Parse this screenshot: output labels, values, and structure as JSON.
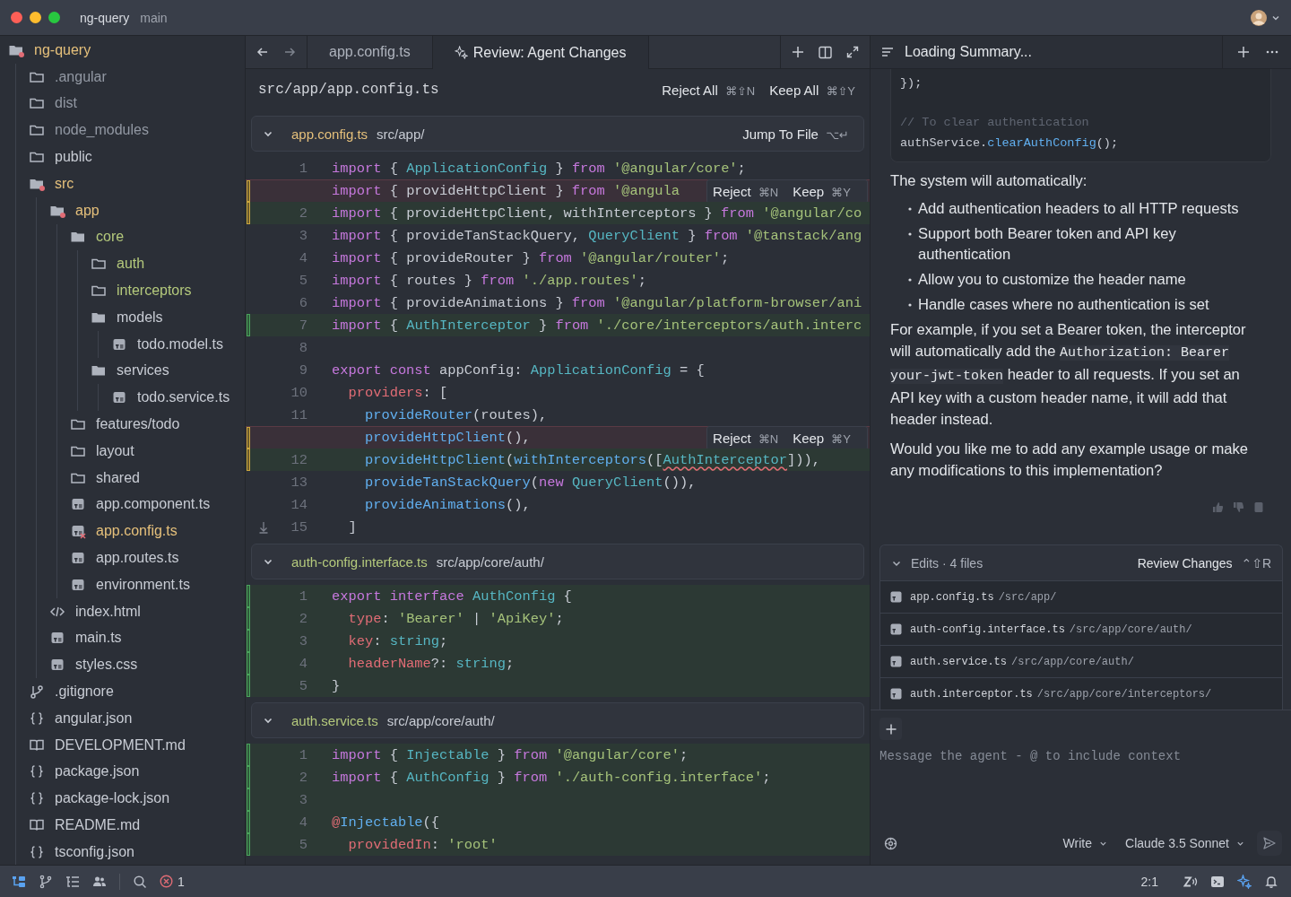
{
  "title_bar": {
    "project": "ng-query",
    "branch": "main"
  },
  "sidebar": {
    "items": [
      {
        "name": "ng-query",
        "kind": "folder-open",
        "color": "#e5c07b",
        "modified": true,
        "children": [
          {
            "name": ".angular",
            "kind": "folder",
            "color": "#9298a3",
            "modified": false
          },
          {
            "name": "dist",
            "kind": "folder",
            "color": "#9298a3",
            "modified": false
          },
          {
            "name": "node_modules",
            "kind": "folder",
            "color": "#9298a3",
            "modified": false
          },
          {
            "name": "public",
            "kind": "folder",
            "color": "#c8ccd4",
            "modified": false
          },
          {
            "name": "src",
            "kind": "folder-open",
            "color": "#e5c07b",
            "modified": true,
            "children": [
              {
                "name": "app",
                "kind": "folder-open",
                "color": "#e5c07b",
                "modified": true,
                "children": [
                  {
                    "name": "core",
                    "kind": "folder-open",
                    "color": "#b4c97c",
                    "modified": false,
                    "children": [
                      {
                        "name": "auth",
                        "kind": "folder",
                        "color": "#b4c97c",
                        "modified": false
                      },
                      {
                        "name": "interceptors",
                        "kind": "folder",
                        "color": "#b4c97c",
                        "modified": false
                      },
                      {
                        "name": "models",
                        "kind": "folder-open",
                        "color": "#c8ccd4",
                        "modified": false,
                        "children": [
                          {
                            "name": "todo.model.ts",
                            "kind": "ts",
                            "color": "#c8ccd4",
                            "modified": false
                          }
                        ]
                      },
                      {
                        "name": "services",
                        "kind": "folder-open",
                        "color": "#c8ccd4",
                        "modified": false,
                        "children": [
                          {
                            "name": "todo.service.ts",
                            "kind": "ts",
                            "color": "#c8ccd4",
                            "modified": false
                          }
                        ]
                      }
                    ]
                  },
                  {
                    "name": "features/todo",
                    "kind": "folder",
                    "color": "#c8ccd4",
                    "modified": false
                  },
                  {
                    "name": "layout",
                    "kind": "folder",
                    "color": "#c8ccd4",
                    "modified": false
                  },
                  {
                    "name": "shared",
                    "kind": "folder",
                    "color": "#c8ccd4",
                    "modified": false
                  },
                  {
                    "name": "app.component.ts",
                    "kind": "ts",
                    "color": "#c8ccd4",
                    "modified": false
                  },
                  {
                    "name": "app.config.ts",
                    "kind": "ts",
                    "color": "#e5c07b",
                    "modified": true
                  },
                  {
                    "name": "app.routes.ts",
                    "kind": "ts",
                    "color": "#c8ccd4",
                    "modified": false
                  },
                  {
                    "name": "environment.ts",
                    "kind": "ts",
                    "color": "#c8ccd4",
                    "modified": false
                  }
                ]
              },
              {
                "name": "index.html",
                "kind": "html",
                "color": "#c8ccd4",
                "modified": false
              },
              {
                "name": "main.ts",
                "kind": "ts",
                "color": "#c8ccd4",
                "modified": false
              },
              {
                "name": "styles.css",
                "kind": "css",
                "color": "#c8ccd4",
                "modified": false
              }
            ]
          },
          {
            "name": ".gitignore",
            "kind": "git",
            "color": "#c8ccd4",
            "modified": false
          },
          {
            "name": "angular.json",
            "kind": "json",
            "color": "#c8ccd4",
            "modified": false
          },
          {
            "name": "DEVELOPMENT.md",
            "kind": "md",
            "color": "#c8ccd4",
            "modified": false
          },
          {
            "name": "package.json",
            "kind": "json",
            "color": "#c8ccd4",
            "modified": false
          },
          {
            "name": "package-lock.json",
            "kind": "json",
            "color": "#c8ccd4",
            "modified": false
          },
          {
            "name": "README.md",
            "kind": "md",
            "color": "#c8ccd4",
            "modified": false
          },
          {
            "name": "tsconfig.json",
            "kind": "json",
            "color": "#c8ccd4",
            "modified": false
          }
        ]
      }
    ]
  },
  "editor": {
    "tabs": [
      {
        "label": "app.config.ts",
        "kind": "file",
        "selected": false
      },
      {
        "label": "Review: Agent Changes",
        "kind": "review",
        "selected": true
      }
    ],
    "review_header": {
      "path": "src/app/app.config.ts",
      "actions": [
        {
          "label": "Reject All",
          "keys": "⌘⇧N"
        },
        {
          "label": "Keep All",
          "keys": "⌘⇧Y"
        }
      ]
    },
    "sections": [
      {
        "name": "app.config.ts",
        "path": "src/app/",
        "color": "#e5c07b",
        "expanded": true,
        "jump": {
          "label": "Jump To File",
          "keys": "⌥↵"
        },
        "lines": [
          {
            "num": "1",
            "kind": "plain",
            "tokens": [
              {
                "kind": "keyword",
                "text": "import"
              },
              {
                "kind": "plain",
                "text": " { "
              },
              {
                "kind": "type",
                "text": "ApplicationConfig"
              },
              {
                "kind": "plain",
                "text": " } "
              },
              {
                "kind": "keyword",
                "text": "from "
              },
              {
                "kind": "string",
                "text": "'@angular/core'"
              },
              {
                "kind": "plain",
                "text": ";"
              }
            ]
          },
          {
            "kind": "removed",
            "tokens": [
              {
                "kind": "keyword",
                "text": "import"
              },
              {
                "kind": "plain",
                "text": " { provideHttpClient } "
              },
              {
                "kind": "keyword",
                "text": "from "
              },
              {
                "kind": "string",
                "text": "'@angula"
              }
            ],
            "actions": [
              {
                "label": "Reject",
                "keys": "⌘N"
              },
              {
                "label": "Keep",
                "keys": "⌘Y"
              }
            ]
          },
          {
            "num": "2",
            "kind": "changed",
            "tokens": [
              {
                "kind": "keyword",
                "text": "import"
              },
              {
                "kind": "plain",
                "text": " { provideHttpClient, withInterceptors } "
              },
              {
                "kind": "keyword",
                "text": "from "
              },
              {
                "kind": "string",
                "text": "'@angular/co"
              }
            ]
          },
          {
            "num": "3",
            "kind": "plain",
            "tokens": [
              {
                "kind": "keyword",
                "text": "import"
              },
              {
                "kind": "plain",
                "text": " { provideTanStackQuery, "
              },
              {
                "kind": "type",
                "text": "QueryClient"
              },
              {
                "kind": "plain",
                "text": " } "
              },
              {
                "kind": "keyword",
                "text": "from "
              },
              {
                "kind": "string",
                "text": "'@tanstack/ang"
              }
            ]
          },
          {
            "num": "4",
            "kind": "plain",
            "tokens": [
              {
                "kind": "keyword",
                "text": "import"
              },
              {
                "kind": "plain",
                "text": " { provideRouter } "
              },
              {
                "kind": "keyword",
                "text": "from "
              },
              {
                "kind": "string",
                "text": "'@angular/router'"
              },
              {
                "kind": "plain",
                "text": ";"
              }
            ]
          },
          {
            "num": "5",
            "kind": "plain",
            "tokens": [
              {
                "kind": "keyword",
                "text": "import"
              },
              {
                "kind": "plain",
                "text": " { routes } "
              },
              {
                "kind": "keyword",
                "text": "from "
              },
              {
                "kind": "string",
                "text": "'./app.routes'"
              },
              {
                "kind": "plain",
                "text": ";"
              }
            ]
          },
          {
            "num": "6",
            "kind": "plain",
            "tokens": [
              {
                "kind": "keyword",
                "text": "import"
              },
              {
                "kind": "plain",
                "text": " { provideAnimations } "
              },
              {
                "kind": "keyword",
                "text": "from "
              },
              {
                "kind": "string",
                "text": "'@angular/platform-browser/ani"
              }
            ]
          },
          {
            "num": "7",
            "kind": "added",
            "tokens": [
              {
                "kind": "keyword",
                "text": "import"
              },
              {
                "kind": "plain",
                "text": " { "
              },
              {
                "kind": "type",
                "text": "AuthInterceptor"
              },
              {
                "kind": "plain",
                "text": " } "
              },
              {
                "kind": "keyword",
                "text": "from "
              },
              {
                "kind": "string",
                "text": "'./core/interceptors/auth.interc"
              }
            ]
          },
          {
            "num": "8",
            "kind": "plain"
          },
          {
            "num": "9",
            "kind": "plain",
            "tokens": [
              {
                "kind": "keyword",
                "text": "export const"
              },
              {
                "kind": "plain",
                "text": " appConfig: "
              },
              {
                "kind": "type",
                "text": "ApplicationConfig"
              },
              {
                "kind": "plain",
                "text": " = {"
              }
            ]
          },
          {
            "num": "10",
            "kind": "plain",
            "tokens": [
              {
                "kind": "property",
                "text": "  providers"
              },
              {
                "kind": "plain",
                "text": ": ["
              }
            ]
          },
          {
            "num": "11",
            "kind": "plain",
            "tokens": [
              {
                "kind": "function",
                "text": "    provideRouter"
              },
              {
                "kind": "plain",
                "text": "(routes),"
              }
            ]
          },
          {
            "kind": "removed",
            "tokens": [
              {
                "kind": "function",
                "text": "    provideHttpClient"
              },
              {
                "kind": "plain",
                "text": "(),"
              }
            ],
            "actions": [
              {
                "label": "Reject",
                "keys": "⌘N"
              },
              {
                "label": "Keep",
                "keys": "⌘Y"
              }
            ]
          },
          {
            "num": "12",
            "kind": "changed",
            "tokens": [
              {
                "kind": "function",
                "text": "    provideHttpClient"
              },
              {
                "kind": "plain",
                "text": "("
              },
              {
                "kind": "function",
                "text": "withInterceptors"
              },
              {
                "kind": "plain",
                "text": "(["
              },
              {
                "kind": "error",
                "text": "AuthInterceptor"
              },
              {
                "kind": "plain",
                "text": "])),"
              }
            ]
          },
          {
            "num": "13",
            "kind": "plain",
            "tokens": [
              {
                "kind": "function",
                "text": "    provideTanStackQuery"
              },
              {
                "kind": "plain",
                "text": "("
              },
              {
                "kind": "keyword",
                "text": "new "
              },
              {
                "kind": "type",
                "text": "QueryClient"
              },
              {
                "kind": "plain",
                "text": "()),"
              }
            ]
          },
          {
            "num": "14",
            "kind": "plain",
            "tokens": [
              {
                "kind": "function",
                "text": "    provideAnimations"
              },
              {
                "kind": "plain",
                "text": "(),"
              }
            ]
          },
          {
            "num": "15",
            "kind": "plain",
            "fold": true,
            "tokens": [
              {
                "kind": "plain",
                "text": "  ]"
              }
            ]
          }
        ]
      },
      {
        "name": "auth-config.interface.ts",
        "path": "src/app/core/auth/",
        "color": "#b4c97c",
        "expanded": true,
        "lines": [
          {
            "num": "1",
            "kind": "added",
            "tokens": [
              {
                "kind": "keyword",
                "text": "export interface "
              },
              {
                "kind": "type",
                "text": "AuthConfig"
              },
              {
                "kind": "plain",
                "text": " {"
              }
            ]
          },
          {
            "num": "2",
            "kind": "added",
            "tokens": [
              {
                "kind": "property",
                "text": "  type"
              },
              {
                "kind": "plain",
                "text": ": "
              },
              {
                "kind": "string",
                "text": "'Bearer'"
              },
              {
                "kind": "plain",
                "text": " | "
              },
              {
                "kind": "string",
                "text": "'ApiKey'"
              },
              {
                "kind": "plain",
                "text": ";"
              }
            ]
          },
          {
            "num": "3",
            "kind": "added",
            "tokens": [
              {
                "kind": "property",
                "text": "  key"
              },
              {
                "kind": "plain",
                "text": ": "
              },
              {
                "kind": "type",
                "text": "string"
              },
              {
                "kind": "plain",
                "text": ";"
              }
            ]
          },
          {
            "num": "4",
            "kind": "added",
            "tokens": [
              {
                "kind": "property",
                "text": "  headerName"
              },
              {
                "kind": "plain",
                "text": "?: "
              },
              {
                "kind": "type",
                "text": "string"
              },
              {
                "kind": "plain",
                "text": ";"
              }
            ]
          },
          {
            "num": "5",
            "kind": "added",
            "tokens": [
              {
                "kind": "plain",
                "text": "}"
              }
            ]
          }
        ]
      },
      {
        "name": "auth.service.ts",
        "path": "src/app/core/auth/",
        "color": "#b4c97c",
        "expanded": true,
        "lines": [
          {
            "num": "1",
            "kind": "added",
            "tokens": [
              {
                "kind": "keyword",
                "text": "import"
              },
              {
                "kind": "plain",
                "text": " { "
              },
              {
                "kind": "type",
                "text": "Injectable"
              },
              {
                "kind": "plain",
                "text": " } "
              },
              {
                "kind": "keyword",
                "text": "from "
              },
              {
                "kind": "string",
                "text": "'@angular/core'"
              },
              {
                "kind": "plain",
                "text": ";"
              }
            ]
          },
          {
            "num": "2",
            "kind": "added",
            "tokens": [
              {
                "kind": "keyword",
                "text": "import"
              },
              {
                "kind": "plain",
                "text": " { "
              },
              {
                "kind": "type",
                "text": "AuthConfig"
              },
              {
                "kind": "plain",
                "text": " } "
              },
              {
                "kind": "keyword",
                "text": "from "
              },
              {
                "kind": "string",
                "text": "'./auth-config.interface'"
              },
              {
                "kind": "plain",
                "text": ";"
              }
            ]
          },
          {
            "num": "3",
            "kind": "added"
          },
          {
            "num": "4",
            "kind": "added",
            "tokens": [
              {
                "kind": "property",
                "text": "@"
              },
              {
                "kind": "function",
                "text": "Injectable"
              },
              {
                "kind": "plain",
                "text": "({"
              }
            ]
          },
          {
            "num": "5",
            "kind": "added",
            "tokens": [
              {
                "kind": "property",
                "text": "  providedIn"
              },
              {
                "kind": "plain",
                "text": ": "
              },
              {
                "kind": "string",
                "text": "'root'"
              }
            ]
          }
        ]
      }
    ]
  },
  "chat": {
    "title": "Loading Summary...",
    "code_block": [
      {
        "spaced": false,
        "tokens": [
          {
            "kind": "plain",
            "text": "});"
          }
        ]
      },
      {
        "spaced": true,
        "tokens": [
          {
            "kind": "comment",
            "text": "// To clear authentication"
          }
        ]
      },
      {
        "spaced": false,
        "tokens": [
          {
            "kind": "plain",
            "text": "authService."
          },
          {
            "kind": "function",
            "text": "clearAuthConfig"
          },
          {
            "kind": "plain",
            "text": "();"
          }
        ]
      }
    ],
    "intro": "The system will automatically:",
    "bullets": [
      "Add authentication headers to all HTTP requests",
      "Support both Bearer token and API key authentication",
      "Allow you to customize the header name",
      "Handle cases where no authentication is set"
    ],
    "paragraph": [
      {
        "kind": "text",
        "text": "For example, if you set a Bearer token, the interceptor will automatically add the "
      },
      {
        "kind": "code",
        "text": "Authorization: Bearer your-jwt-token"
      },
      {
        "kind": "text",
        "text": " header to all requests. If you set an API key with a custom header name, it will add that header instead."
      }
    ],
    "question": "Would you like me to add any example usage or make any modifications to this implementation?",
    "edits": {
      "title": "Edits · 4 files",
      "expanded": true,
      "action": {
        "label": "Review Changes",
        "keys": "⌃⇧R"
      },
      "files": [
        {
          "name": "app.config.ts",
          "path": "/src/app/"
        },
        {
          "name": "auth-config.interface.ts",
          "path": "/src/app/core/auth/"
        },
        {
          "name": "auth.service.ts",
          "path": "/src/app/core/auth/"
        },
        {
          "name": "auth.interceptor.ts",
          "path": "/src/app/core/interceptors/"
        }
      ]
    },
    "composer": {
      "placeholder": "Message the agent - @ to include context",
      "mode": "Write",
      "model": "Claude 3.5 Sonnet"
    }
  },
  "status_bar": {
    "left_tools": [
      {
        "kind": "tree",
        "selected": true
      },
      {
        "kind": "branch",
        "selected": false
      },
      {
        "kind": "outline",
        "selected": false
      },
      {
        "kind": "people",
        "selected": false
      },
      {
        "kind": "search",
        "selected": false
      }
    ],
    "errors": "1",
    "cursor": "2:1",
    "right_tools": [
      {
        "kind": "zigzag",
        "selected": false
      },
      {
        "kind": "terminal",
        "selected": false
      },
      {
        "kind": "sparkle",
        "selected": true
      },
      {
        "kind": "bell",
        "selected": false
      }
    ]
  }
}
